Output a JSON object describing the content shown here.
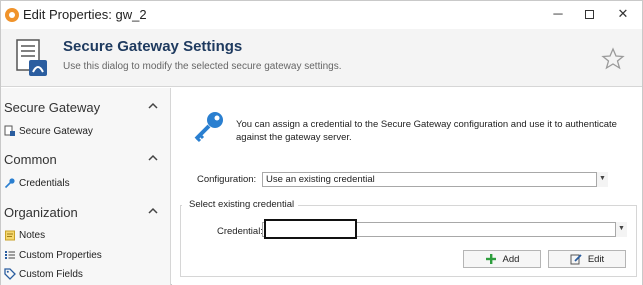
{
  "window": {
    "title": "Edit Properties: gw_2",
    "controls": {
      "minimize": "─",
      "maximize": "□",
      "close": "✕"
    }
  },
  "header": {
    "title": "Secure Gateway Settings",
    "subtitle": "Use this dialog to modify the selected secure gateway settings."
  },
  "sidebar": {
    "sections": [
      {
        "label": "Secure Gateway",
        "items": [
          {
            "label": "Secure Gateway",
            "icon": "gateway-icon"
          }
        ]
      },
      {
        "label": "Common",
        "items": [
          {
            "label": "Credentials",
            "icon": "key-icon"
          }
        ]
      },
      {
        "label": "Organization",
        "items": [
          {
            "label": "Notes",
            "icon": "notes-icon"
          },
          {
            "label": "Custom Properties",
            "icon": "list-icon"
          },
          {
            "label": "Custom Fields",
            "icon": "tag-icon"
          }
        ]
      }
    ]
  },
  "main": {
    "info": "You can assign a credential to the Secure Gateway configuration and use it to authenticate against the gateway server.",
    "configuration": {
      "label": "Configuration:",
      "value": "Use an existing credential"
    },
    "group_title": "Select existing credential",
    "credential": {
      "label": "Credential:",
      "value": ""
    },
    "buttons": {
      "add": "Add",
      "edit": "Edit"
    }
  },
  "colors": {
    "accent": "#1e3a5f",
    "key_blue": "#2a7fd0",
    "add_green": "#2e9e3e",
    "app_icon": "#f0932b"
  }
}
